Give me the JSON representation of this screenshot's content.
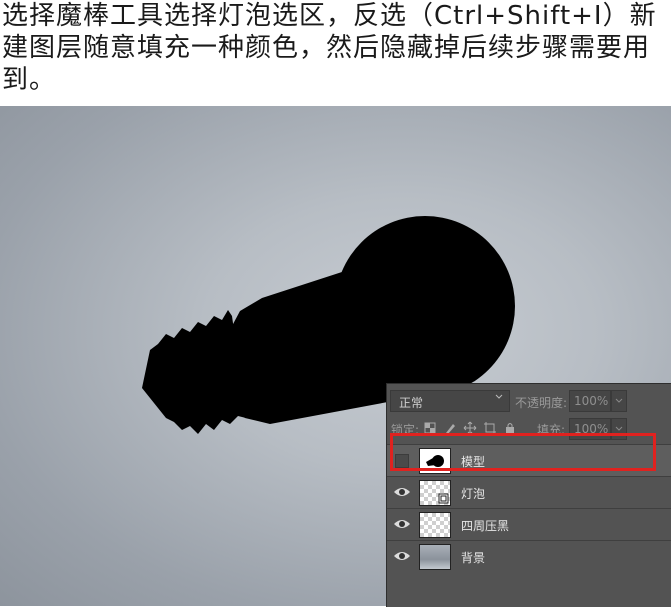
{
  "instruction": "选择魔棒工具选择灯泡选区，反选（Ctrl+Shift+I）新建图层随意填充一种颜色，然后隐藏掉后续步骤需要用到。",
  "layers_panel": {
    "blend_mode": "正常",
    "opacity_label": "不透明度:",
    "opacity_value": "100%",
    "lock_label": "锁定:",
    "fill_label": "填充:",
    "fill_value": "100%",
    "layers": [
      {
        "name": "模型",
        "visible": false,
        "selected": true,
        "thumb": "black-mask"
      },
      {
        "name": "灯泡",
        "visible": true,
        "selected": false,
        "thumb": "smart-object"
      },
      {
        "name": "四周压黑",
        "visible": true,
        "selected": false,
        "thumb": "transparent"
      },
      {
        "name": "背景",
        "visible": true,
        "selected": false,
        "thumb": "gradient"
      }
    ]
  },
  "colors": {
    "highlight": "#e0221f",
    "panel_bg": "#535353",
    "silhouette": "#000000"
  }
}
